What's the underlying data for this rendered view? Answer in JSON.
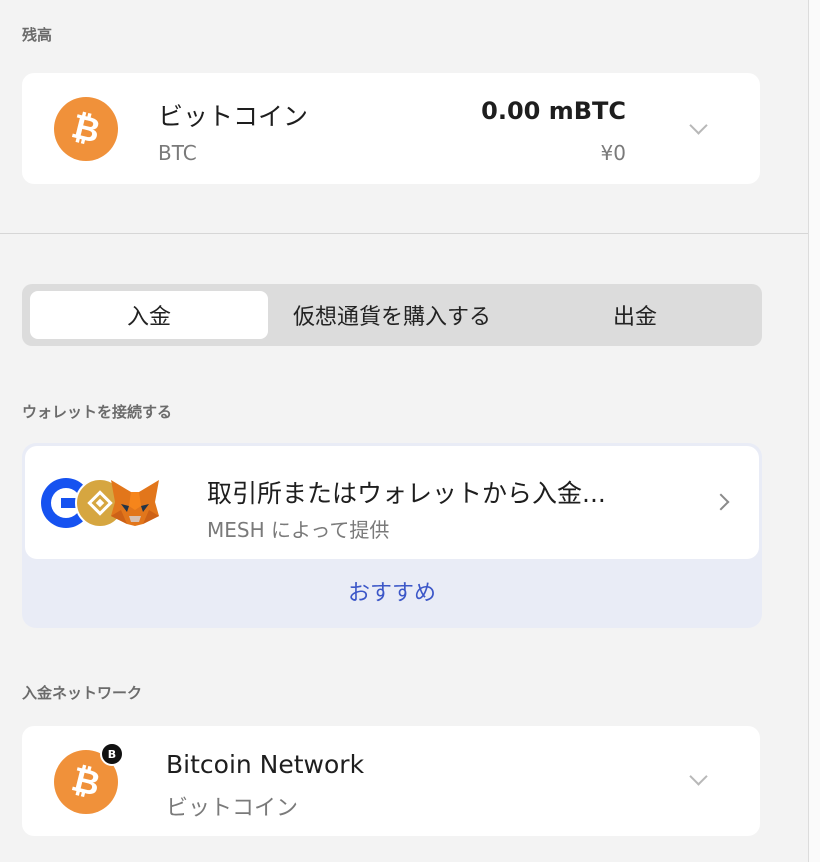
{
  "balance": {
    "section_label": "残高",
    "coin_symbol": "₿",
    "coin_name": "ビットコイン",
    "ticker": "BTC",
    "amount": "0.00 mBTC",
    "fiat": "¥0"
  },
  "tabs": [
    {
      "label": "入金",
      "active": true
    },
    {
      "label": "仮想通貨を購入する",
      "active": false
    },
    {
      "label": "出金",
      "active": false
    }
  ],
  "wallet": {
    "section_label": "ウォレットを接続する",
    "title": "取引所またはウォレットから入金...",
    "subtitle": "MESH によって提供",
    "recommend": "おすすめ"
  },
  "network": {
    "section_label": "入金ネットワーク",
    "coin_symbol": "₿",
    "badge_symbol": "B",
    "name": "Bitcoin Network",
    "sub": "ビットコイン"
  },
  "colors": {
    "bitcoin_orange": "#f0913a",
    "accent_blue": "#3c57c8",
    "coinbase_blue": "#1652f0",
    "binance_gold": "#d6a640",
    "metamask_orange": "#e2761b"
  },
  "icons": [
    "bitcoin-icon",
    "chevron-down-icon",
    "chevron-right-icon",
    "coinbase-logo-icon",
    "binance-logo-icon",
    "metamask-logo-icon"
  ]
}
